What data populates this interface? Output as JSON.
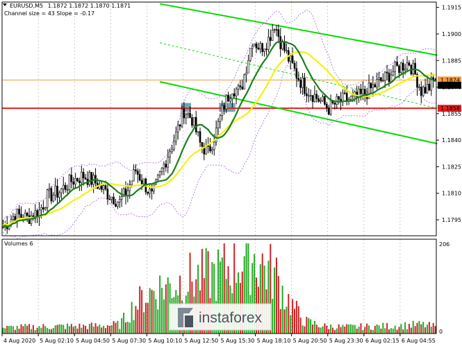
{
  "chart_data": {
    "type": "candlestick",
    "symbol": "EURUSD,M5",
    "ohlc_header": "1.1872 1.1872 1.1870 1.1871",
    "indicator_label": "Channel size = 43 Slope = -0.17",
    "price_ylim": [
      1.1786,
      1.1918
    ],
    "price_ticks": [
      "1.1915",
      "1.1900",
      "1.1885",
      "1.1870",
      "1.1855",
      "1.1840",
      "1.1825",
      "1.1810",
      "1.1795"
    ],
    "price_tick_values": [
      1.1915,
      1.19,
      1.1885,
      1.187,
      1.1855,
      1.184,
      1.1825,
      1.181,
      1.1795
    ],
    "price_markers": [
      {
        "label": "1.1874",
        "value": 1.1874,
        "color": "#f39c3c"
      },
      {
        "label": "1.1871",
        "value": 1.1871,
        "color": "#000000"
      },
      {
        "label": "1.1858",
        "value": 1.1858,
        "color": "#e41e1e"
      }
    ],
    "horizontal_lines": [
      {
        "value": 1.1874,
        "color": "#f39c3c"
      },
      {
        "value": 1.1858,
        "color": "#e41e1e"
      }
    ],
    "time_labels": [
      "4 Aug 2020",
      "5 Aug 02:10",
      "5 Aug 04:50",
      "5 Aug 07:30",
      "5 Aug 10:10",
      "5 Aug 12:50",
      "5 Aug 15:30",
      "5 Aug 18:10",
      "5 Aug 20:50",
      "5 Aug 23:30",
      "6 Aug 02:15",
      "6 Aug 04:55"
    ],
    "volume_label": "Volumes 6",
    "volume_max_label": "206",
    "volume_zero_label": "0",
    "volume_max_value": 206,
    "price_path_keypoints": [
      [
        0,
        1.1791
      ],
      [
        6,
        1.1798
      ],
      [
        12,
        1.1796
      ],
      [
        18,
        1.18
      ],
      [
        22,
        1.1808
      ],
      [
        28,
        1.1811
      ],
      [
        34,
        1.1817
      ],
      [
        40,
        1.182
      ],
      [
        46,
        1.1816
      ],
      [
        52,
        1.181
      ],
      [
        58,
        1.1805
      ],
      [
        62,
        1.1812
      ],
      [
        66,
        1.1823
      ],
      [
        70,
        1.1816
      ],
      [
        74,
        1.1808
      ],
      [
        78,
        1.182
      ],
      [
        82,
        1.1832
      ],
      [
        86,
        1.1843
      ],
      [
        90,
        1.1857
      ],
      [
        94,
        1.1852
      ],
      [
        98,
        1.1838
      ],
      [
        102,
        1.1833
      ],
      [
        106,
        1.1845
      ],
      [
        110,
        1.186
      ],
      [
        114,
        1.187
      ],
      [
        118,
        1.1867
      ],
      [
        121,
        1.1882
      ],
      [
        124,
        1.1897
      ],
      [
        128,
        1.1892
      ],
      [
        132,
        1.1897
      ],
      [
        135,
        1.1906
      ],
      [
        138,
        1.1896
      ],
      [
        142,
        1.1886
      ],
      [
        146,
        1.1877
      ],
      [
        150,
        1.187
      ],
      [
        154,
        1.1866
      ],
      [
        158,
        1.1862
      ],
      [
        162,
        1.1858
      ],
      [
        166,
        1.1861
      ],
      [
        170,
        1.1863
      ],
      [
        174,
        1.1863
      ],
      [
        178,
        1.1865
      ],
      [
        182,
        1.1868
      ],
      [
        186,
        1.1872
      ],
      [
        190,
        1.1875
      ],
      [
        194,
        1.1879
      ],
      [
        198,
        1.1882
      ],
      [
        202,
        1.1884
      ],
      [
        205,
        1.1877
      ],
      [
        208,
        1.1868
      ],
      [
        212,
        1.187
      ],
      [
        215,
        1.1875
      ]
    ],
    "candle_count": 216,
    "candle_seed": 7,
    "volume_profile": [
      [
        0,
        14
      ],
      [
        10,
        16
      ],
      [
        20,
        17
      ],
      [
        30,
        18
      ],
      [
        40,
        18
      ],
      [
        50,
        20
      ],
      [
        58,
        22
      ],
      [
        64,
        60
      ],
      [
        70,
        90
      ],
      [
        76,
        110
      ],
      [
        84,
        120
      ],
      [
        92,
        135
      ],
      [
        100,
        140
      ],
      [
        108,
        150
      ],
      [
        116,
        175
      ],
      [
        122,
        195
      ],
      [
        126,
        186
      ],
      [
        130,
        165
      ],
      [
        136,
        140
      ],
      [
        140,
        95
      ],
      [
        146,
        55
      ],
      [
        150,
        30
      ],
      [
        160,
        18
      ],
      [
        170,
        16
      ],
      [
        180,
        17
      ],
      [
        190,
        18
      ],
      [
        200,
        20
      ],
      [
        208,
        22
      ],
      [
        215,
        17
      ]
    ],
    "highlights": [
      {
        "label": "",
        "x_index": [
          89,
          93
        ],
        "y_range": [
          1.1856,
          1.1861
        ]
      },
      {
        "label": "",
        "x_index": [
          108,
          115
        ],
        "y_range": [
          1.1856,
          1.1861
        ]
      }
    ],
    "channel_lines": [
      {
        "name": "",
        "points": [
          [
            78,
            1.1917
          ],
          [
            216,
            1.1888
          ]
        ],
        "style": "solid",
        "color": "#00dd00"
      },
      {
        "name": "",
        "points": [
          [
            78,
            1.1895
          ],
          [
            216,
            1.1858
          ]
        ],
        "style": "dashed",
        "color": "#00dd00"
      },
      {
        "name": "",
        "points": [
          [
            78,
            1.1873
          ],
          [
            216,
            1.1838
          ]
        ],
        "style": "solid",
        "color": "#00dd00"
      }
    ],
    "colors": {
      "up_candle": "#000000",
      "down_candle": "#000000",
      "ma_fast": "#1a7f1a",
      "ma_slow": "#f2f20c",
      "bands": "#b77de0",
      "volume_up": "#22aa22",
      "volume_down": "#cc2222",
      "highlight": "#3b8aa0",
      "panel_border": "#000000",
      "separator": "#aaaaaa"
    }
  },
  "watermark": {
    "text": "instaforex"
  }
}
